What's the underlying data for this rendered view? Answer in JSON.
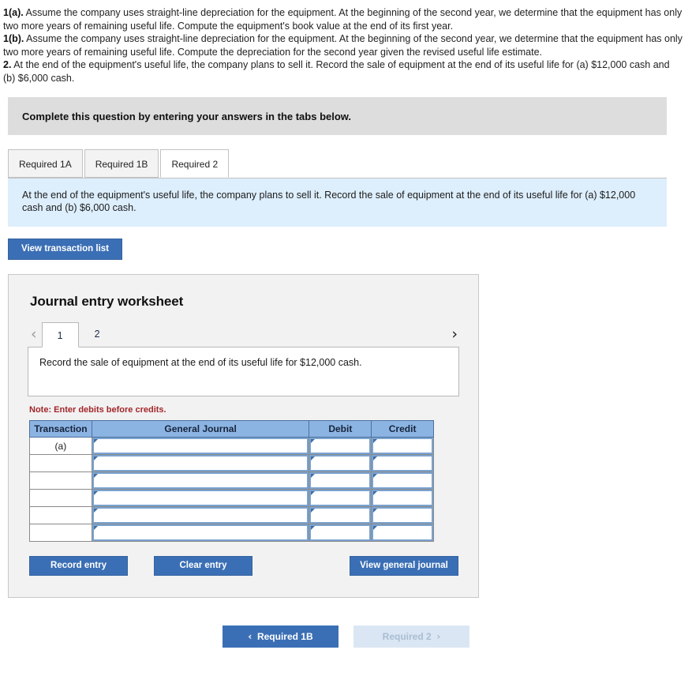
{
  "prompt": {
    "line1_label": "1(a).",
    "line1_text": " Assume the company uses straight-line depreciation for the equipment. At the beginning of the second year, we determine that the equipment has only two more years of remaining useful life. Compute the equipment's book value at the end of its first year.",
    "line2_label": "1(b).",
    "line2_text": " Assume the company uses straight-line depreciation for the equipment. At the beginning of the second year, we determine that the equipment has only two more years of remaining useful life. Compute the depreciation for the second year given the revised useful life estimate.",
    "line3_label": "2.",
    "line3_text": " At the end of the equipment's useful life, the company plans to sell it. Record the sale of equipment at the end of its useful life for (a) $12,000 cash and (b) $6,000 cash."
  },
  "banner": {
    "text": "Complete this question by entering your answers in the tabs below."
  },
  "tabs": [
    {
      "label": "Required 1A",
      "active": false
    },
    {
      "label": "Required 1B",
      "active": false
    },
    {
      "label": "Required 2",
      "active": true
    }
  ],
  "infobox": {
    "text": "At the end of the equipment's useful life, the company plans to sell it. Record the sale of equipment at the end of its useful life for (a) $12,000 cash and (b) $6,000 cash."
  },
  "view_transaction_list": {
    "label": "View transaction list"
  },
  "worksheet": {
    "title": "Journal entry worksheet",
    "pager": {
      "prev_icon": "‹",
      "next_icon": "›",
      "pages": [
        "1",
        "2"
      ],
      "active_page": "1"
    },
    "entry_description": "Record the sale of equipment at the end of its useful life for $12,000 cash.",
    "note": "Note: Enter debits before credits.",
    "table": {
      "headers": [
        "Transaction",
        "General Journal",
        "Debit",
        "Credit"
      ],
      "rows": [
        {
          "transaction": "(a)",
          "general_journal": "",
          "debit": "",
          "credit": ""
        },
        {
          "transaction": "",
          "general_journal": "",
          "debit": "",
          "credit": ""
        },
        {
          "transaction": "",
          "general_journal": "",
          "debit": "",
          "credit": ""
        },
        {
          "transaction": "",
          "general_journal": "",
          "debit": "",
          "credit": ""
        },
        {
          "transaction": "",
          "general_journal": "",
          "debit": "",
          "credit": ""
        },
        {
          "transaction": "",
          "general_journal": "",
          "debit": "",
          "credit": ""
        }
      ]
    },
    "actions": {
      "record_entry": "Record entry",
      "clear_entry": "Clear entry",
      "view_general_journal": "View general journal"
    }
  },
  "bottom_nav": {
    "prev_label": "Required 1B",
    "prev_chevron": "‹",
    "next_label": "Required 2",
    "next_chevron": "›",
    "next_disabled": true
  },
  "colors": {
    "primary_blue": "#3b6fb5",
    "table_header_blue": "#8cb4e3",
    "infobox_blue": "#ddeefc",
    "banner_gray": "#dddddd",
    "note_red": "#a3262a",
    "disabled_blue": "#dae6f3"
  }
}
